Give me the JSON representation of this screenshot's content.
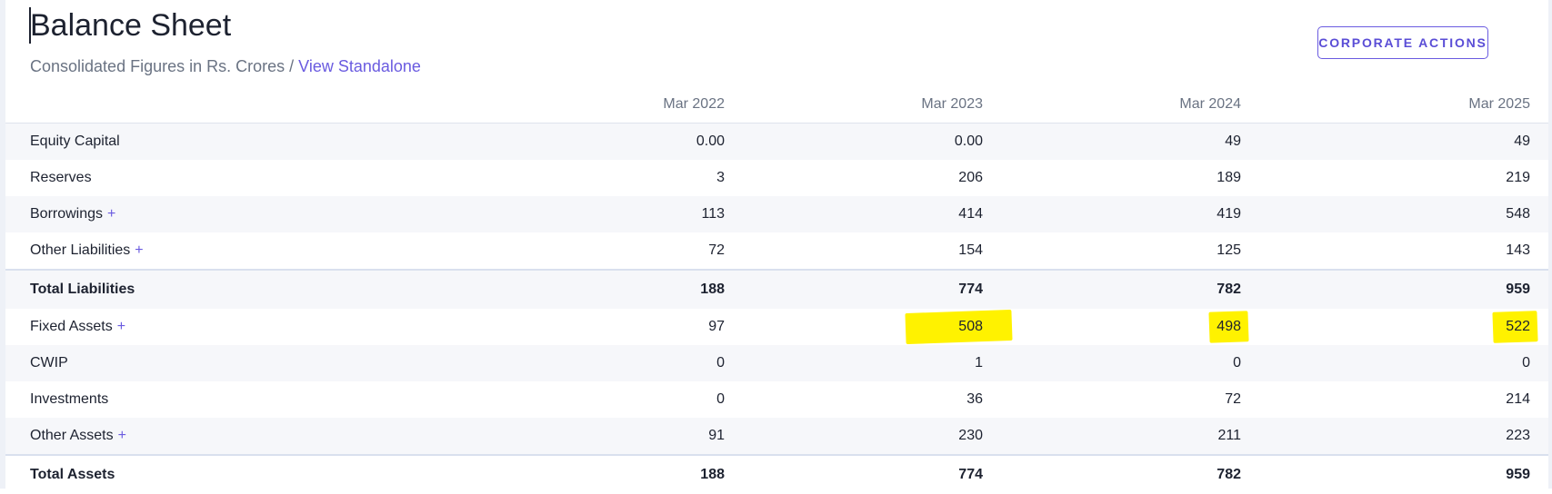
{
  "header": {
    "title": "Balance Sheet",
    "subtitle": "Consolidated Figures in Rs. Crores",
    "separator": " / ",
    "link": "View Standalone",
    "action_button": "CORPORATE ACTIONS"
  },
  "table": {
    "columns": [
      "Mar 2022",
      "Mar 2023",
      "Mar 2024",
      "Mar 2025"
    ],
    "rows": [
      {
        "label": "Equity Capital",
        "expandable": false,
        "values": [
          "0.00",
          "0.00",
          "49",
          "49"
        ]
      },
      {
        "label": "Reserves",
        "expandable": false,
        "values": [
          "3",
          "206",
          "189",
          "219"
        ]
      },
      {
        "label": "Borrowings",
        "expandable": true,
        "plus": "+",
        "values": [
          "113",
          "414",
          "419",
          "548"
        ]
      },
      {
        "label": "Other Liabilities",
        "expandable": true,
        "plus": "+",
        "values": [
          "72",
          "154",
          "125",
          "143"
        ]
      },
      {
        "label": "Total Liabilities",
        "expandable": false,
        "values": [
          "188",
          "774",
          "782",
          "959"
        ]
      },
      {
        "label": "Fixed Assets",
        "expandable": true,
        "plus": "+",
        "values": [
          "97",
          "508",
          "498",
          "522"
        ]
      },
      {
        "label": "CWIP",
        "expandable": false,
        "values": [
          "0",
          "1",
          "0",
          "0"
        ]
      },
      {
        "label": "Investments",
        "expandable": false,
        "values": [
          "0",
          "36",
          "72",
          "214"
        ]
      },
      {
        "label": "Other Assets",
        "expandable": true,
        "plus": "+",
        "values": [
          "91",
          "230",
          "211",
          "223"
        ]
      },
      {
        "label": "Total Assets",
        "expandable": false,
        "values": [
          "188",
          "774",
          "782",
          "959"
        ]
      }
    ]
  },
  "colors": {
    "accent": "#6a5be0",
    "highlight": "#fff200",
    "stripe": "#f6f7fa",
    "muted_text": "#6a7383"
  }
}
